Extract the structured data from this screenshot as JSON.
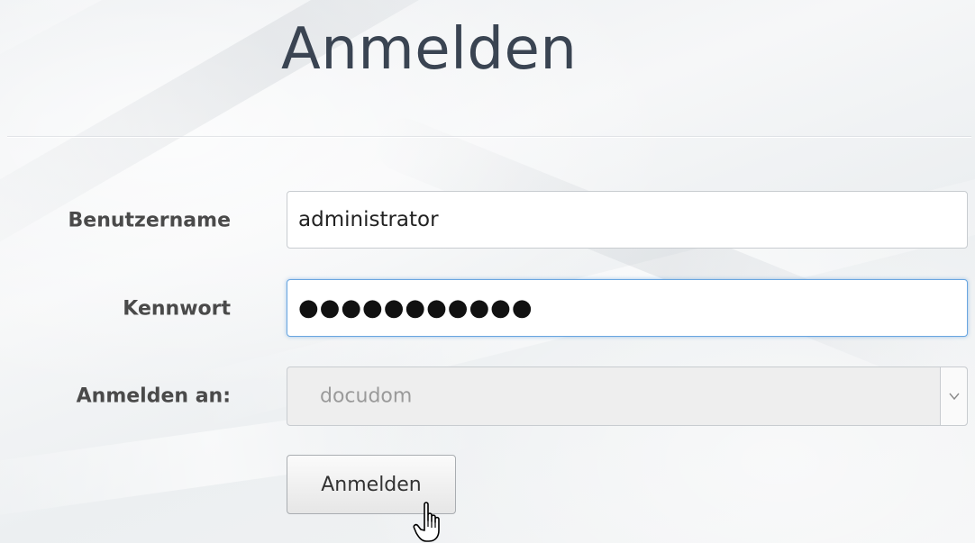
{
  "login": {
    "title": "Anmelden",
    "username": {
      "label": "Benutzername",
      "value": "administrator"
    },
    "password": {
      "label": "Kennwort",
      "masked_value": "●●●●●●●●●●●"
    },
    "domain": {
      "label": "Anmelden an:",
      "selected": "docudom"
    },
    "submit_label": "Anmelden"
  },
  "icons": {
    "dropdown": "chevron-down-icon",
    "cursor": "hand-pointer-icon"
  },
  "colors": {
    "title": "#3a4452",
    "label": "#4a4a4a",
    "focus": "#6aa6e0",
    "disabled_bg": "#eeeeee"
  }
}
